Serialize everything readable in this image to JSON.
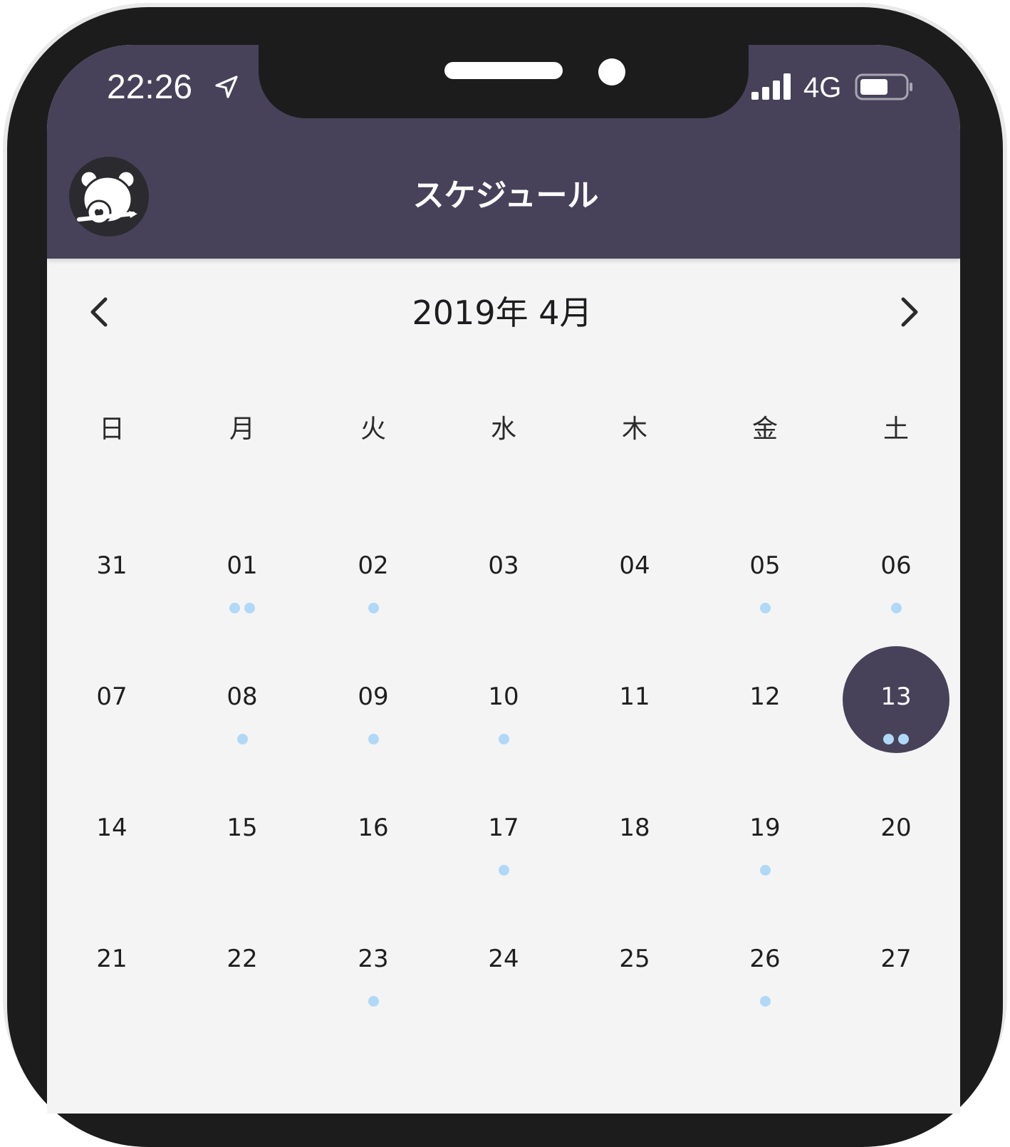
{
  "colors": {
    "header_bg": "#47425a",
    "screen_bg": "#f4f4f5",
    "dot": "#b1d8f6",
    "selected_bg": "#47425a"
  },
  "status_bar": {
    "time": "22:26",
    "network": "4G",
    "location_icon": "location-arrow-icon",
    "signal_icon": "signal-bars-icon",
    "battery_icon": "battery-icon"
  },
  "header": {
    "title": "スケジュール",
    "avatar_icon": "bear-avatar-icon"
  },
  "calendar": {
    "month_title": "2019年 4月",
    "prev_icon": "chevron-left-icon",
    "next_icon": "chevron-right-icon",
    "weekdays": [
      "日",
      "月",
      "火",
      "水",
      "木",
      "金",
      "土"
    ],
    "weeks": [
      [
        {
          "label": "31",
          "dots": 0
        },
        {
          "label": "01",
          "dots": 2
        },
        {
          "label": "02",
          "dots": 1
        },
        {
          "label": "03",
          "dots": 0
        },
        {
          "label": "04",
          "dots": 0
        },
        {
          "label": "05",
          "dots": 1
        },
        {
          "label": "06",
          "dots": 1
        }
      ],
      [
        {
          "label": "07",
          "dots": 0
        },
        {
          "label": "08",
          "dots": 1
        },
        {
          "label": "09",
          "dots": 1
        },
        {
          "label": "10",
          "dots": 1
        },
        {
          "label": "11",
          "dots": 0
        },
        {
          "label": "12",
          "dots": 0
        },
        {
          "label": "13",
          "dots": 2,
          "selected": true
        }
      ],
      [
        {
          "label": "14",
          "dots": 0
        },
        {
          "label": "15",
          "dots": 0
        },
        {
          "label": "16",
          "dots": 0
        },
        {
          "label": "17",
          "dots": 1
        },
        {
          "label": "18",
          "dots": 0
        },
        {
          "label": "19",
          "dots": 1
        },
        {
          "label": "20",
          "dots": 0
        }
      ],
      [
        {
          "label": "21",
          "dots": 0
        },
        {
          "label": "22",
          "dots": 0
        },
        {
          "label": "23",
          "dots": 1
        },
        {
          "label": "24",
          "dots": 0
        },
        {
          "label": "25",
          "dots": 0
        },
        {
          "label": "26",
          "dots": 1
        },
        {
          "label": "27",
          "dots": 0
        }
      ]
    ]
  }
}
